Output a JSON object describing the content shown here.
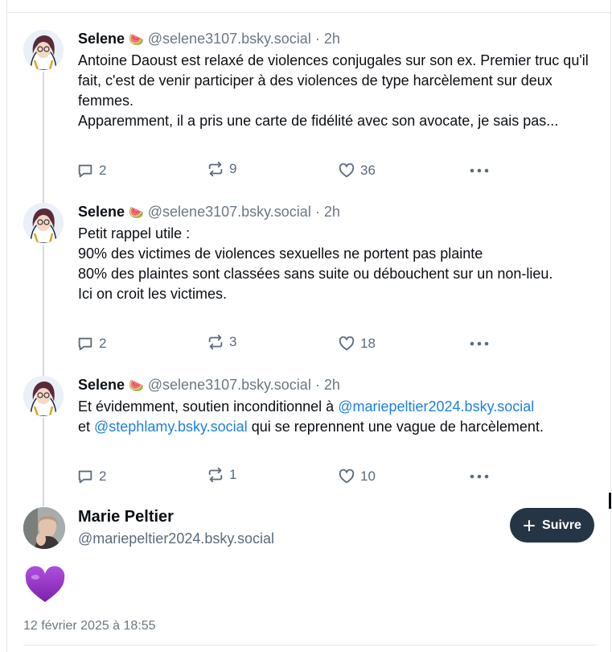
{
  "thread": {
    "posts": [
      {
        "author": "Selene",
        "emoji": "🍉",
        "handle": "@selene3107.bsky.social",
        "separator": "·",
        "time": "2h",
        "text": "Antoine Daoust est relaxé de violences conjugales sur son ex. Premier truc qu'il fait, c'est de venir participer à des violences de type harcèlement sur deux femmes.\nApparemment, il a pris une carte de fidélité avec son avocate, je sais pas...",
        "replies": "2",
        "reposts": "9",
        "likes": "36"
      },
      {
        "author": "Selene",
        "emoji": "🍉",
        "handle": "@selene3107.bsky.social",
        "separator": "·",
        "time": "2h",
        "text": "Petit rappel utile :\n90% des victimes de violences sexuelles ne portent pas plainte\n80% des plaintes sont classées sans suite ou débouchent sur un non-lieu.\nIci on croit les victimes.",
        "replies": "2",
        "reposts": "3",
        "likes": "18"
      },
      {
        "author": "Selene",
        "emoji": "🍉",
        "handle": "@selene3107.bsky.social",
        "separator": "·",
        "time": "2h",
        "text_before": "Et évidemment, soutien inconditionnel à ",
        "mention1": "@mariepeltier2024.bsky.social",
        "text_middle": "\net ",
        "mention2": "@stephlamy.bsky.social",
        "text_after": " qui se reprennent une vague de harcèlement.",
        "replies": "2",
        "reposts": "1",
        "likes": "10"
      }
    ]
  },
  "main_post": {
    "name": "Marie Peltier",
    "handle": "@mariepeltier2024.bsky.social",
    "follow_label": "Suivre",
    "content_emoji": "purple-heart",
    "timestamp": "12 février 2025 à 18:55"
  },
  "colors": {
    "accent": "#1d80e2",
    "follow_button": "#263545",
    "muted": "#6b7785",
    "heart": "#9b35c9"
  }
}
